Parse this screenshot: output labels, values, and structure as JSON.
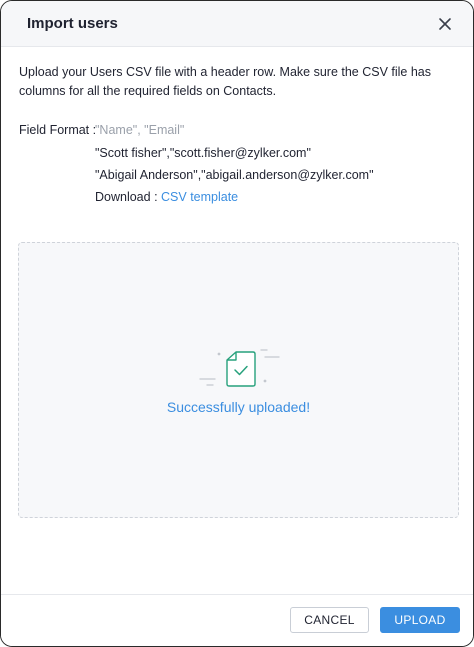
{
  "dialog": {
    "title": "Import users",
    "close_icon": "close-icon"
  },
  "body": {
    "intro": "Upload your Users CSV file with a header row. Make sure the CSV file has columns for all the required fields on Contacts.",
    "field_format_label": "Field Format :",
    "field_format_value": "\"Name\", \"Email\"",
    "example_1": "\"Scott fisher\",\"scott.fisher@zylker.com\"",
    "example_2": "\"Abigail Anderson\",\"abigail.anderson@zylker.com\"",
    "download_label": "Download : ",
    "download_link": "CSV template"
  },
  "dropzone": {
    "status_text": "Successfully uploaded!",
    "icon": "file-check-icon",
    "accent_color": "#27a17c"
  },
  "footer": {
    "cancel_label": "CANCEL",
    "upload_label": "UPLOAD"
  },
  "colors": {
    "primary": "#3b8ee0",
    "success_icon": "#27a17c"
  }
}
